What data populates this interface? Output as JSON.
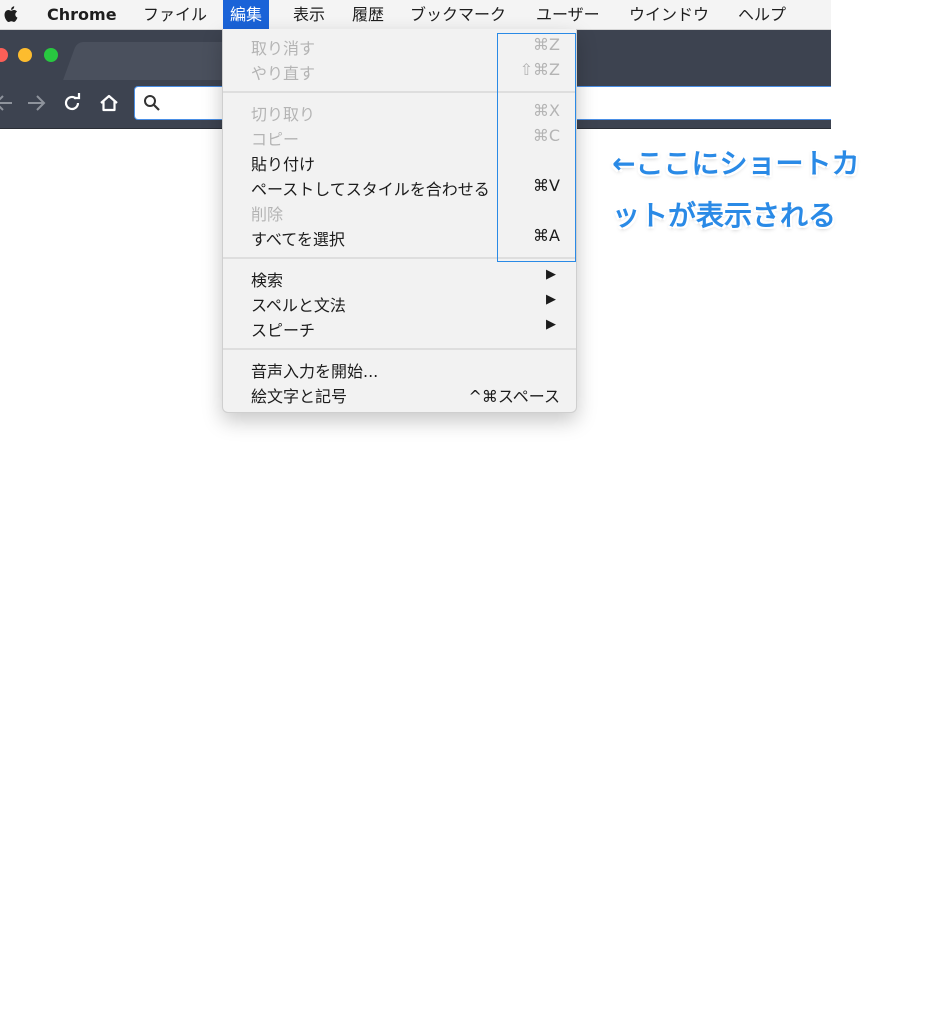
{
  "menubar": {
    "app_name": "Chrome",
    "items": [
      "ファイル",
      "編集",
      "表示",
      "履歴",
      "ブックマーク",
      "ユーザー",
      "ウインドウ",
      "ヘルプ"
    ],
    "active_item": "編集"
  },
  "edit_menu": {
    "undo": {
      "label": "取り消す",
      "shortcut": "⌘Z",
      "enabled": false
    },
    "redo": {
      "label": "やり直す",
      "shortcut": "⇧⌘Z",
      "enabled": false
    },
    "cut": {
      "label": "切り取り",
      "shortcut": "⌘X",
      "enabled": false
    },
    "copy": {
      "label": "コピー",
      "shortcut": "⌘C",
      "enabled": false
    },
    "paste": {
      "label": "貼り付け",
      "shortcut": "",
      "enabled": true
    },
    "paste_match_style": {
      "label": "ペーストしてスタイルを合わせる",
      "shortcut": "⌘V",
      "enabled": true
    },
    "delete": {
      "label": "削除",
      "shortcut": "",
      "enabled": false
    },
    "select_all": {
      "label": "すべてを選択",
      "shortcut": "⌘A",
      "enabled": true
    },
    "find": {
      "label": "検索",
      "arrow": "▶"
    },
    "spelling": {
      "label": "スペルと文法",
      "arrow": "▶"
    },
    "speech": {
      "label": "スピーチ",
      "arrow": "▶"
    },
    "dictation": {
      "label": "音声入力を開始...",
      "shortcut": ""
    },
    "emoji": {
      "label": "絵文字と記号",
      "shortcut": "^⌘スペース"
    }
  },
  "annotation": {
    "line1": "←ここにショートカ",
    "line2": "ットが表示される"
  },
  "colors": {
    "menu_highlight": "#1a63d8",
    "annotation_blue": "#2a8ae6",
    "browser_frame": "#3d4350",
    "close": "#fc5f57",
    "minimize": "#fdbc2e",
    "maximize": "#28c840"
  }
}
